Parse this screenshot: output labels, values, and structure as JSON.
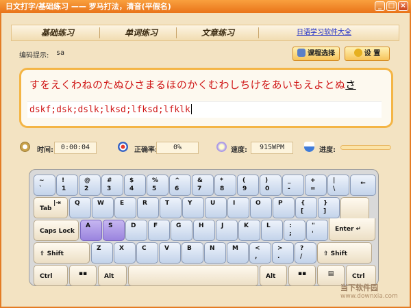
{
  "window": {
    "title": "日文打字/基础练习 —— 罗马打法，清音(平假名)",
    "min_label": "_",
    "max_label": "□",
    "close_label": "×"
  },
  "tabs": [
    {
      "label": "基础练习"
    },
    {
      "label": "单词练习"
    },
    {
      "label": "文章练习"
    }
  ],
  "software_link": "日语学习软件大全",
  "hint": {
    "label": "编码提示:",
    "value": "sa"
  },
  "buttons": {
    "course": "课程选择",
    "settings": "设 置"
  },
  "practice": {
    "kana_done": "すをえくわねのたぬひさまるほのかくむわしちけをあいもえよとぬ",
    "kana_current": "さ",
    "typed": "dskf;dsk;dslk;lksd;lfksd;lfklk"
  },
  "stats": {
    "time_label": "时间:",
    "time_value": "0:00:04",
    "accuracy_label": "正确率:",
    "accuracy_value": "0%",
    "speed_label": "速度:",
    "speed_value": "915WPM",
    "progress_label": "进度:",
    "progress": 0.0
  },
  "keyboard": {
    "row1": [
      [
        "~",
        "`"
      ],
      [
        "!",
        "1"
      ],
      [
        "@",
        "2"
      ],
      [
        "#",
        "3"
      ],
      [
        "$",
        "4"
      ],
      [
        "%",
        "5"
      ],
      [
        "^",
        "6"
      ],
      [
        "&",
        "7"
      ],
      [
        "*",
        "8"
      ],
      [
        "(",
        "9"
      ],
      [
        ")",
        "0"
      ],
      [
        "_",
        "-"
      ],
      [
        "+",
        "="
      ],
      [
        "|",
        "\\"
      ],
      [
        "←",
        ""
      ]
    ],
    "row2": [
      "Q",
      "W",
      "E",
      "R",
      "T",
      "Y",
      "U",
      "I",
      "O",
      "P"
    ],
    "row2_brackets": [
      [
        "{",
        "["
      ],
      [
        "}",
        "]"
      ]
    ],
    "row3": [
      "A",
      "S",
      "D",
      "F",
      "G",
      "H",
      "J",
      "K",
      "L"
    ],
    "row3_punct": [
      [
        ":",
        ";"
      ],
      [
        "\"",
        "'"
      ]
    ],
    "row4": [
      "Z",
      "X",
      "C",
      "V",
      "B",
      "N",
      "M"
    ],
    "row4_punct": [
      [
        "<",
        ","
      ],
      [
        ">",
        "."
      ],
      [
        "?",
        "/"
      ]
    ],
    "highlighted": [
      "A",
      "S"
    ],
    "tab": "Tab",
    "tab_arrows": "|⇥",
    "caps": "Caps Lock",
    "enter": "Enter ↵",
    "shift_left": "⇧ Shift",
    "shift_right": "⇧ Shift",
    "ctrl_left": "Ctrl",
    "ctrl_right": "Ctrl",
    "alt_left": "Alt",
    "alt_right": "Alt"
  },
  "watermark": {
    "cn": "当下软件园",
    "url": "www.downxia.com"
  },
  "colors": {
    "accent": "#e47c24",
    "typed_text": "#d01818",
    "highlight_key": "#9a84de"
  }
}
